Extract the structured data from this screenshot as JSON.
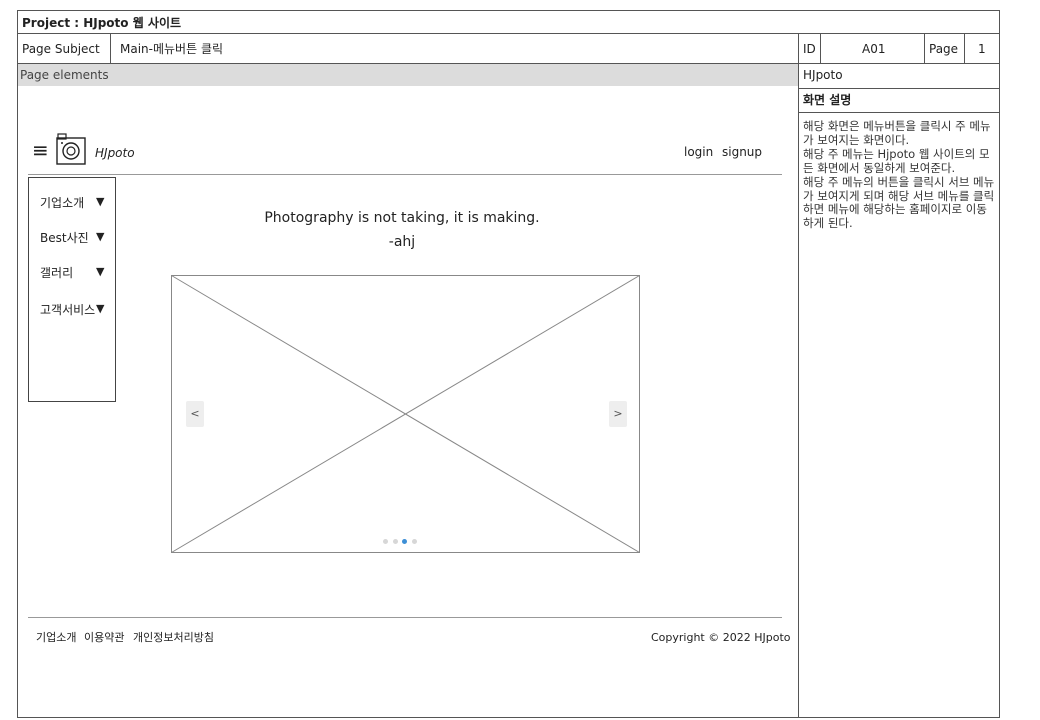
{
  "header": {
    "project_label": "Project : HJpoto 웹 사이트",
    "page_subject_label": "Page Subject",
    "page_subject_value": "Main-메뉴버튼 클릭",
    "id_label": "ID",
    "id_value": "A01",
    "page_label": "Page",
    "page_value": "1",
    "page_elements_label": "Page elements"
  },
  "side_panel": {
    "site_name": "HJpoto",
    "section_title": "화면 설명",
    "paragraphs": [
      "해당 화면은 메뉴버튼을 클릭시 주 메뉴가 보여지는 화면이다.",
      "해당 주 메뉴는 Hjpoto 웹 사이트의 모든 화면에서 동일하게 보여준다.",
      "해당 주 메뉴의 버튼을 클릭시 서브 메뉴가 보여지게 되며 해당 서브 메뉴를 클릭하면 메뉴에 해당하는 홈페이지로 이동하게 된다."
    ]
  },
  "site": {
    "logo_text": "HJpoto",
    "hamburger_glyph": "≡",
    "login_label": "login",
    "signup_label": "signup",
    "quote_line1": "Photography is not taking, it is making.",
    "quote_line2": "-ahj",
    "menu_items": [
      "기업소개",
      "Best사진",
      "갤러리",
      "고객서비스"
    ],
    "menu_arrow": "▼",
    "slider_prev": "<",
    "slider_next": ">",
    "slider_dots": 4,
    "slider_active_dot": 2,
    "footer_links": [
      "기업소개",
      "이용약관",
      "개인정보처리방침"
    ],
    "copyright": "Copyright © 2022 HJpoto"
  },
  "colors": {
    "border": "#555555",
    "header_gray": "#dcdcdc",
    "active_dot": "#3d8fd6"
  }
}
